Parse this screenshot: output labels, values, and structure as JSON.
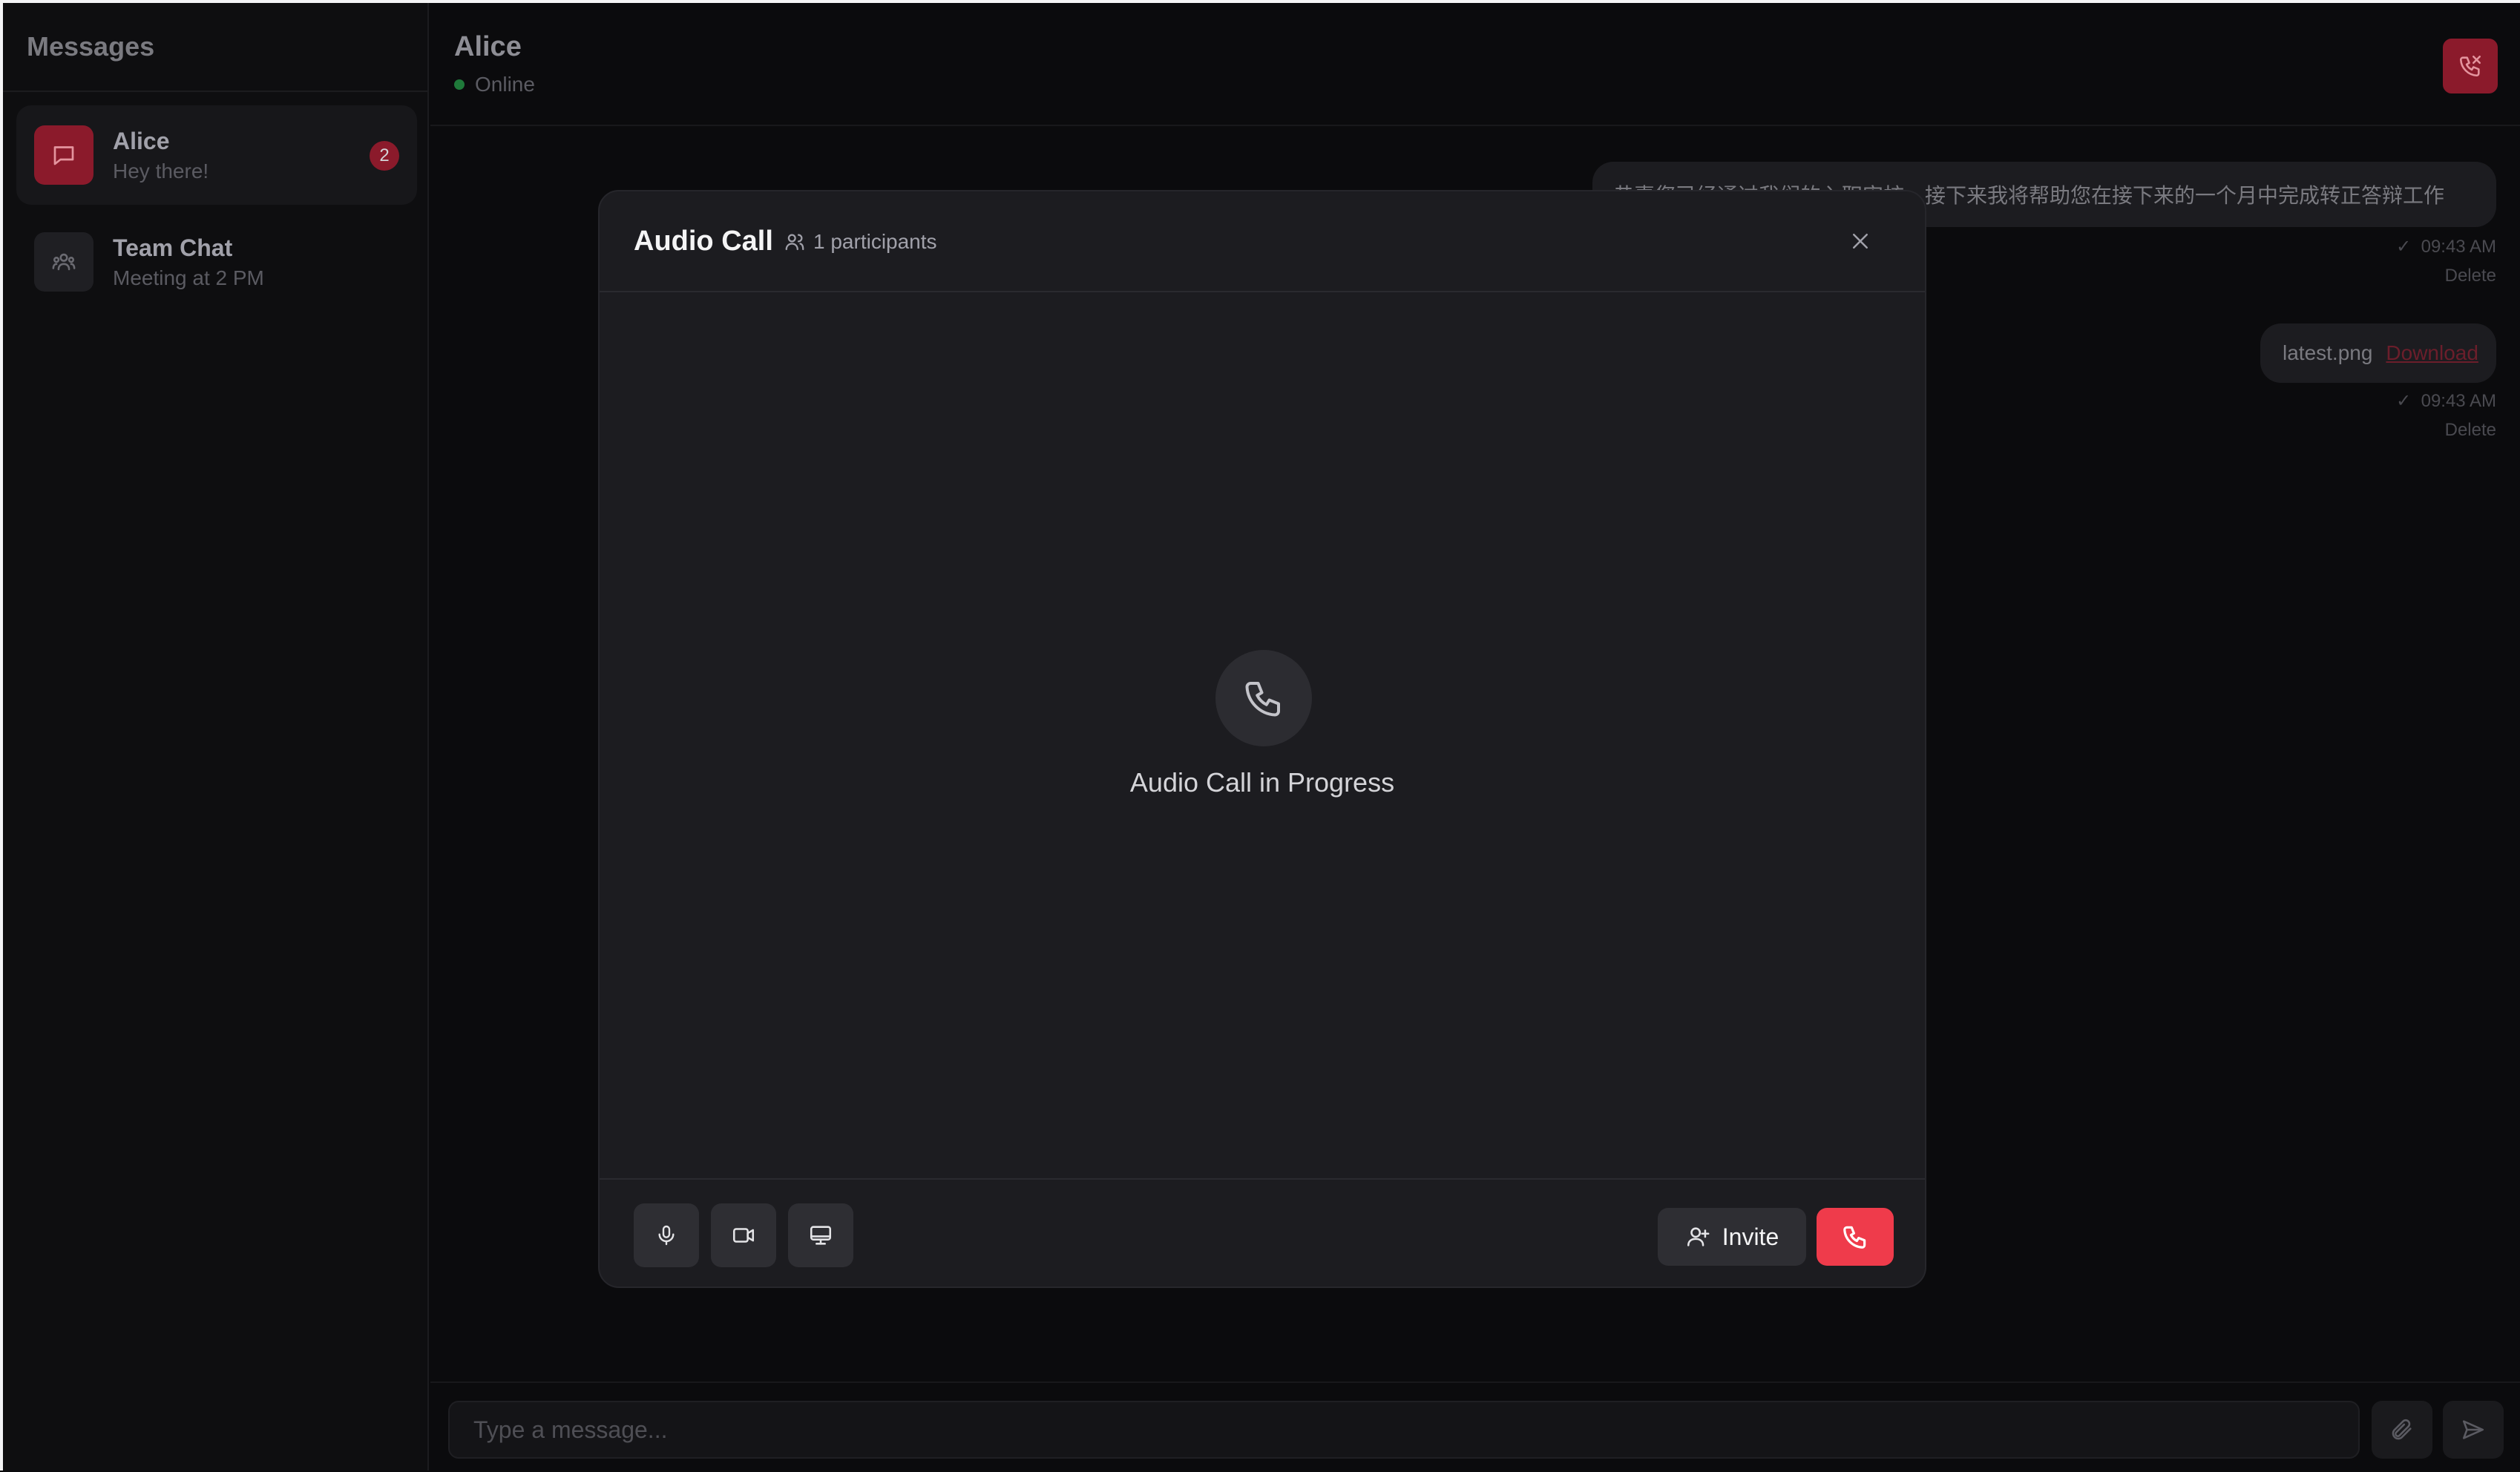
{
  "sidebar": {
    "title": "Messages",
    "conversations": [
      {
        "name": "Alice",
        "preview": "Hey there!",
        "unread": "2",
        "icon": "message-icon"
      },
      {
        "name": "Team Chat",
        "preview": "Meeting at 2 PM",
        "icon": "group-icon"
      }
    ]
  },
  "chat": {
    "contact_name": "Alice",
    "status": "Online",
    "messages": [
      {
        "text": "恭喜您已经通过我们的入职审核，接下来我将帮助您在接下来的一个月中完成转正答辩工作",
        "time": "09:43 AM",
        "delete_label": "Delete"
      },
      {
        "file_name": "latest.png",
        "download_label": "Download",
        "time": "09:43 AM",
        "delete_label": "Delete"
      }
    ]
  },
  "composer": {
    "placeholder": "Type a message..."
  },
  "modal": {
    "title": "Audio Call",
    "participants": "1 participants",
    "status_text": "Audio Call in Progress",
    "invite_label": "Invite"
  },
  "colors": {
    "accent": "#ef3b4b",
    "accent_dim": "#8b1a2b",
    "online": "#1f7a3a",
    "modal_bg": "#1c1c20",
    "page_bg": "#0b0b0d"
  }
}
